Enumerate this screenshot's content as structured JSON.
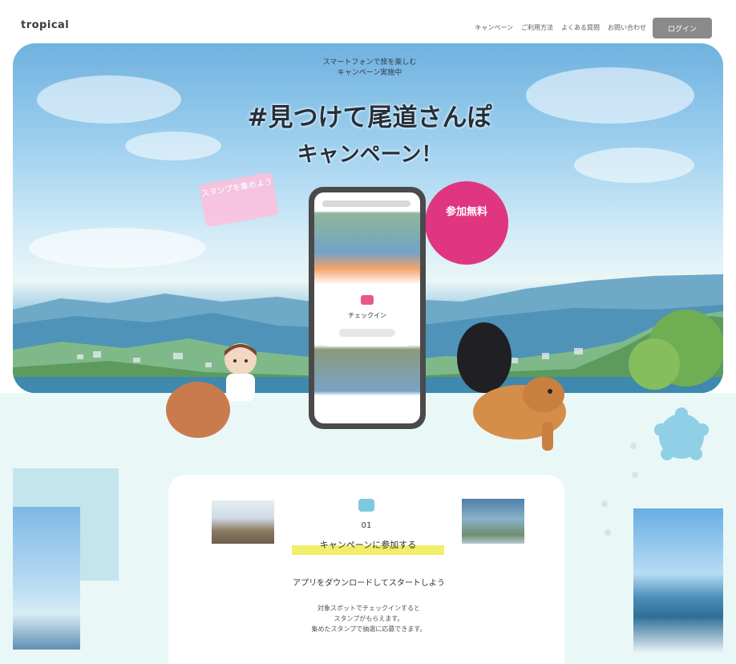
{
  "header": {
    "logo": "tropical",
    "nav": [
      "キャンペーン",
      "ご利用方法",
      "よくある質問",
      "お問い合わせ"
    ],
    "button_label": "ログイン"
  },
  "hero": {
    "tagline_lines": [
      "スマートフォンで旅を楽しむ",
      "キャンペーン実施中"
    ],
    "title_line1": "#見つけて尾道さんぽ",
    "title_line2": "キャンペーン！",
    "pink_label": "スタンプを集めよう",
    "badge_text": "参加無料",
    "phone_card_text": "チェックイン"
  },
  "section": {
    "step_number": "01",
    "highlight_text": "キャンペーンに参加する",
    "subtitle": "アプリをダウンロードしてスタートしよう",
    "body_lines": [
      "対象スポットでチェックインすると",
      "スタンプがもらえます。",
      "集めたスタンプで抽選に応募できます。"
    ]
  },
  "colors": {
    "sky_top": "#6fb1df",
    "badge_pink": "#e03580",
    "lower_bg": "#eaf7f7",
    "highlight_yellow": "#f2ee6a",
    "paw_blue": "#8fd0e6"
  },
  "icons": {
    "paw": "paw-icon",
    "step": "step-icon"
  }
}
